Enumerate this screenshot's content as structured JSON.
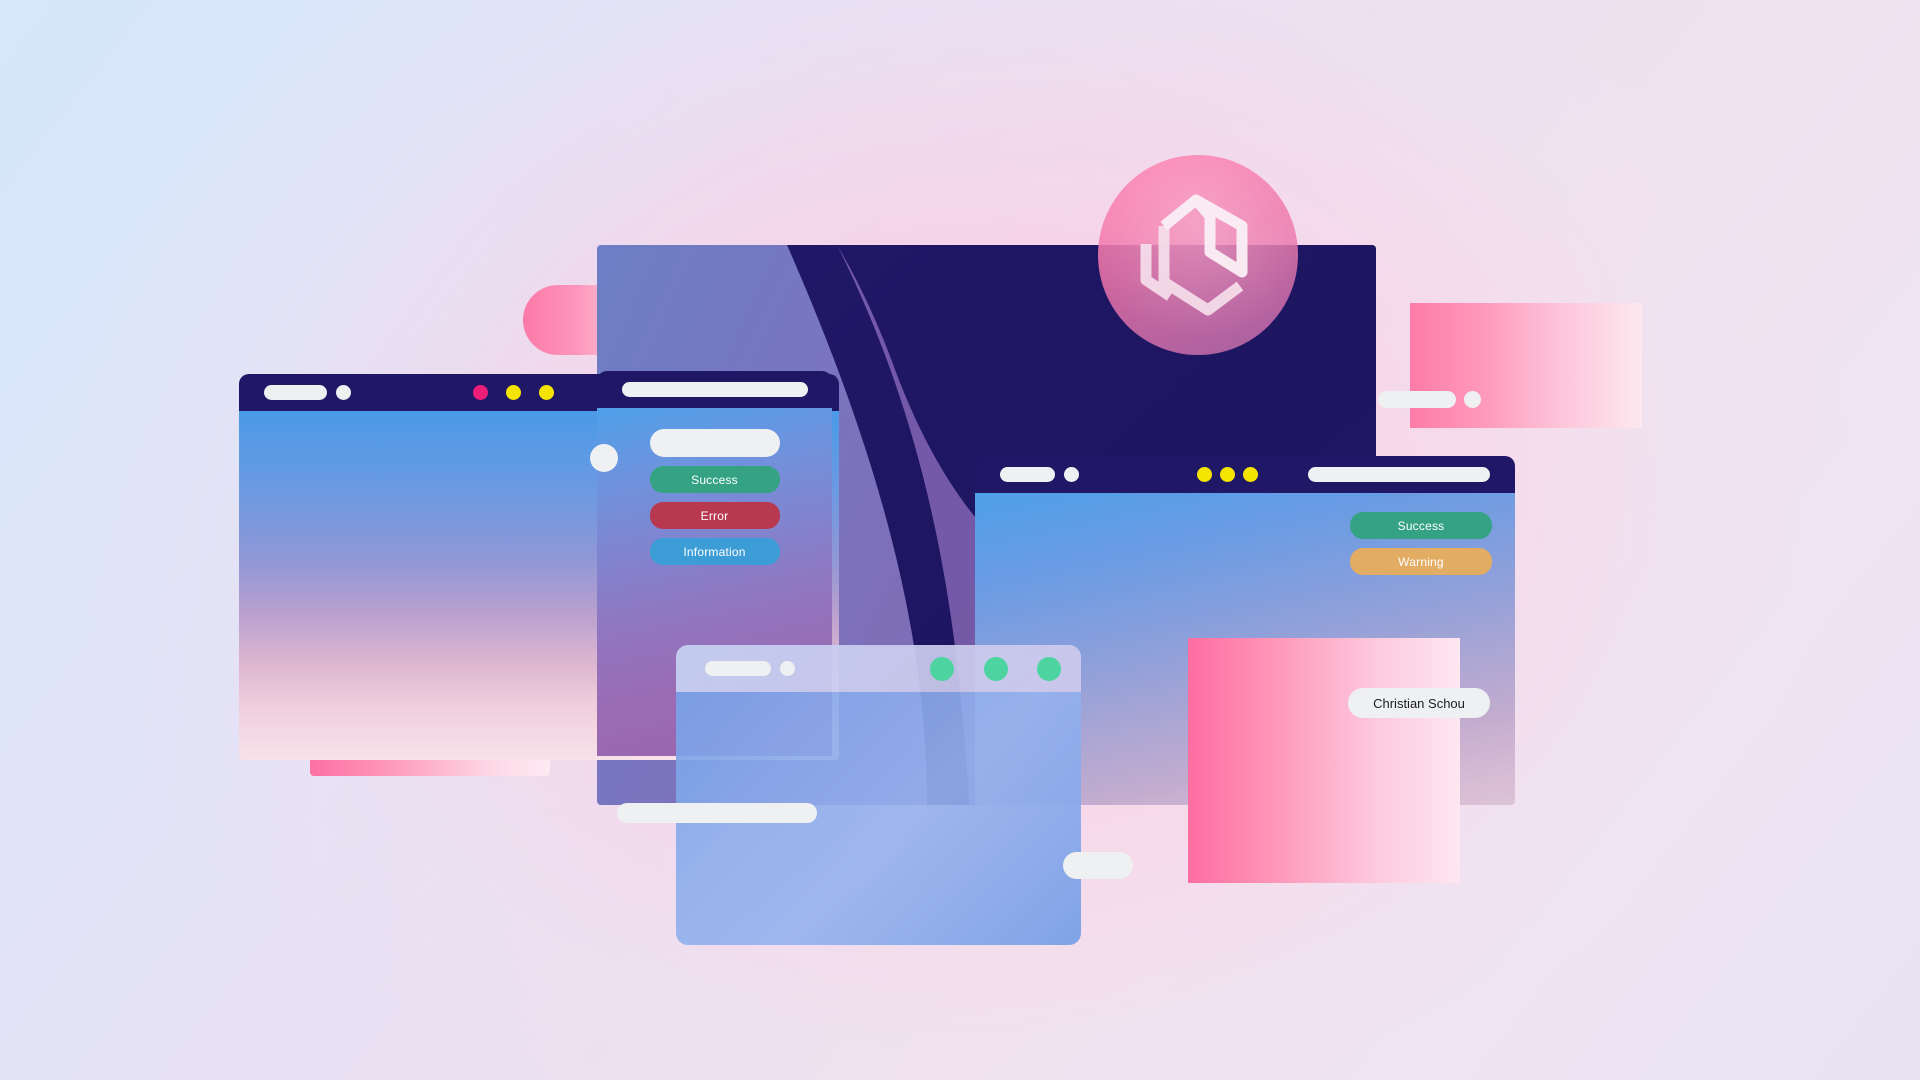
{
  "scene": {
    "title": "Notification components hero illustration",
    "background": {
      "top_left_color": "#d4e7fb",
      "bottom_right_color": "#e8e4f4",
      "glow_color": "#ffbedc"
    }
  },
  "brand": {
    "logo_name": "hexagon-monogram-logo",
    "logo_circle_color": "#ec68a2"
  },
  "monitor": {
    "name": "main-display",
    "screen_color": "#201766",
    "wave_color": "#8a5fae"
  },
  "windows": {
    "left": {
      "name": "browser-window-left",
      "titlebar": {
        "color": "#201766",
        "address_pill": "",
        "menu_dot": "",
        "traffic_lights": [
          {
            "name": "dot-pink",
            "color": "#ec1e79"
          },
          {
            "name": "dot-yellow-1",
            "color": "#f5e400"
          },
          {
            "name": "dot-yellow-2",
            "color": "#f5e400"
          }
        ],
        "search_pill": ""
      }
    },
    "middle": {
      "name": "browser-window-middle",
      "titlebar": {
        "color": "#201766",
        "address_pill": ""
      },
      "input_placeholder": "",
      "buttons": [
        {
          "name": "success-button",
          "label": "Success",
          "color": "#35a383"
        },
        {
          "name": "error-button",
          "label": "Error",
          "color": "#b8394f"
        },
        {
          "name": "information-button",
          "label": "Information",
          "color": "#3c9cd6"
        }
      ]
    },
    "right": {
      "name": "browser-window-right",
      "titlebar": {
        "color": "#201766",
        "address_pill": "",
        "menu_dot": "",
        "traffic_lights": [
          {
            "name": "dot-yellow-1",
            "color": "#f5e400"
          },
          {
            "name": "dot-yellow-2",
            "color": "#f5e400"
          },
          {
            "name": "dot-yellow-3",
            "color": "#f5e400"
          }
        ],
        "search_pill": ""
      },
      "buttons": [
        {
          "name": "success-button",
          "label": "Success",
          "color": "#35a383"
        },
        {
          "name": "warning-button",
          "label": "Warning",
          "color": "#e2ac63"
        }
      ]
    },
    "bottom": {
      "name": "browser-window-bottom",
      "titlebar": {
        "address_pill": "",
        "menu_dot": "",
        "traffic_lights": [
          {
            "name": "dot-green-1",
            "color": "#4dd4a0"
          },
          {
            "name": "dot-green-2",
            "color": "#4dd4a0"
          },
          {
            "name": "dot-green-3",
            "color": "#4dd4a0"
          }
        ]
      }
    }
  },
  "cards": {
    "pink_left": {
      "name": "pink-card-left",
      "start": "#fd6fa2",
      "end": "#fdeaf2"
    },
    "pink_right_top": {
      "name": "pink-card-right-top",
      "start": "#fd7ba8",
      "end": "#fde8f0"
    },
    "pink_right_bottom": {
      "name": "pink-card-right-bottom",
      "start": "#fd6ea1",
      "end": "#fde7f0"
    },
    "pink_pill": {
      "name": "pink-pill-shape",
      "start": "#fb7aa8",
      "end": "#fde3ec"
    }
  },
  "chips": {
    "user": {
      "name": "user-name-chip",
      "label": "Christian Schou"
    }
  }
}
